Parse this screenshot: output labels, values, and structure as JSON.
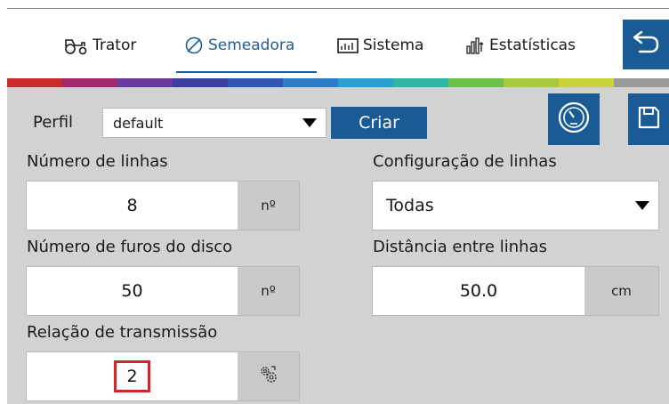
{
  "tabs": [
    {
      "label": "Trator",
      "icon": "tractor-icon"
    },
    {
      "label": "Semeadora",
      "icon": "leaf-icon",
      "active": true
    },
    {
      "label": "Sistema",
      "icon": "display-icon"
    },
    {
      "label": "Estatísticas",
      "icon": "bar-chart-icon"
    }
  ],
  "header": {
    "back_icon": "back-arrow-icon"
  },
  "stripe_colors": [
    "#c92a2a",
    "#a12b6a",
    "#6a3a9c",
    "#3d3f9e",
    "#2f57b3",
    "#2c7cc8",
    "#2aa0cf",
    "#2fb6a3",
    "#6cbf4a",
    "#a9c93a",
    "#c9d23a",
    "#9a9a9a"
  ],
  "profile": {
    "label": "Perfil",
    "selected": "default",
    "create_label": "Criar",
    "gauge_icon": "gauge-icon",
    "save_icon": "save-icon"
  },
  "fields": {
    "num_rows": {
      "label": "Número de linhas",
      "value": "8",
      "unit": "nº"
    },
    "row_config": {
      "label": "Configuração de linhas",
      "selected": "Todas"
    },
    "disc_holes": {
      "label": "Número de furos do disco",
      "value": "50",
      "unit": "nº"
    },
    "row_spacing": {
      "label": "Distância entre linhas",
      "value": "50.0",
      "unit": "cm"
    },
    "transmission": {
      "label": "Relação de transmissão",
      "value": "2",
      "unit_icon": "gears-icon"
    }
  },
  "colors": {
    "accent": "#1a5b95",
    "panel": "#d1d2d4",
    "highlight": "#d6242a"
  }
}
